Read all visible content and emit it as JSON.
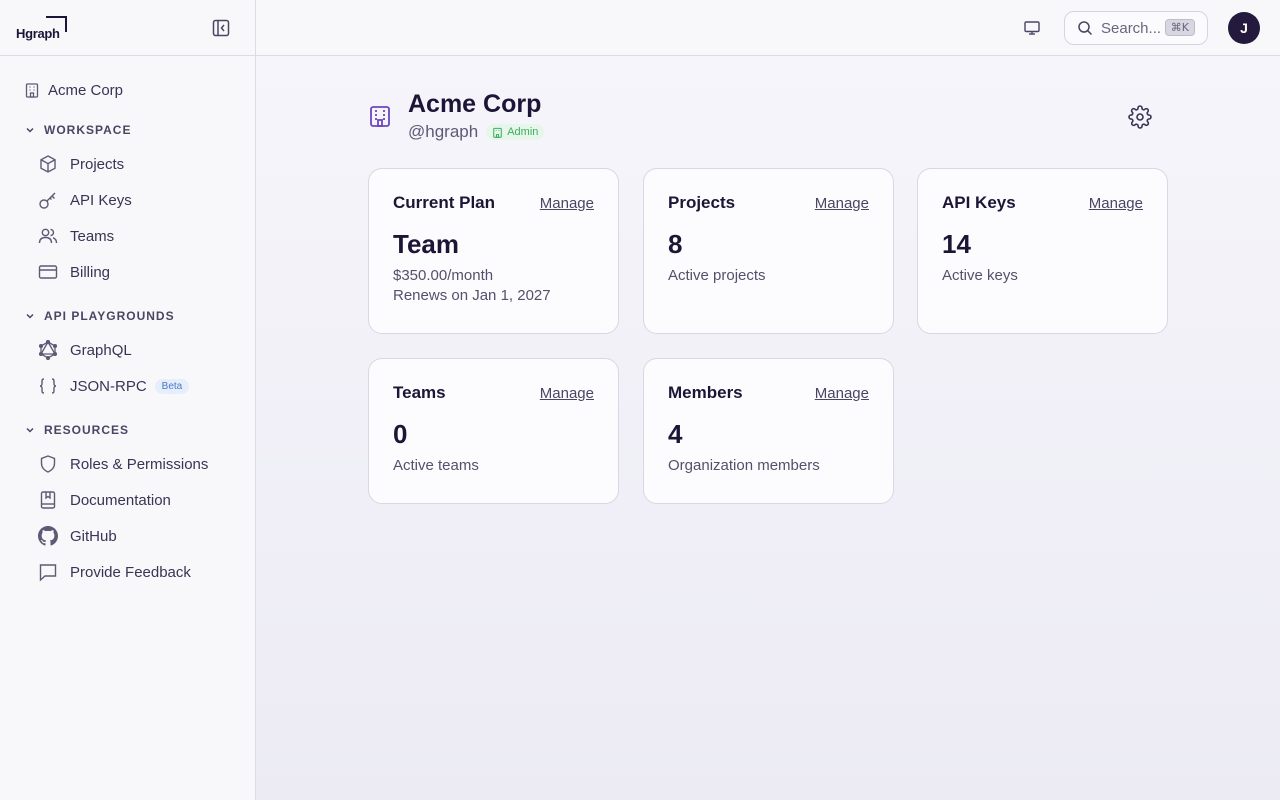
{
  "app": {
    "logo": "Hgraph"
  },
  "sidebar": {
    "org": "Acme Corp",
    "sections": [
      {
        "title": "WORKSPACE",
        "items": [
          {
            "label": "Projects",
            "icon": "cube-icon"
          },
          {
            "label": "API Keys",
            "icon": "key-icon"
          },
          {
            "label": "Teams",
            "icon": "users-icon"
          },
          {
            "label": "Billing",
            "icon": "credit-card-icon"
          }
        ]
      },
      {
        "title": "API PLAYGROUNDS",
        "items": [
          {
            "label": "GraphQL",
            "icon": "graphql-icon"
          },
          {
            "label": "JSON-RPC",
            "icon": "braces-icon",
            "badge": "Beta"
          }
        ]
      },
      {
        "title": "RESOURCES",
        "items": [
          {
            "label": "Roles & Permissions",
            "icon": "shield-icon"
          },
          {
            "label": "Documentation",
            "icon": "book-icon"
          },
          {
            "label": "GitHub",
            "icon": "github-icon"
          },
          {
            "label": "Provide Feedback",
            "icon": "message-icon"
          }
        ]
      }
    ]
  },
  "header": {
    "search_placeholder": "Search...",
    "search_shortcut": "⌘K",
    "avatar_initial": "J"
  },
  "org": {
    "name": "Acme Corp",
    "handle": "@hgraph",
    "role_badge": "Admin"
  },
  "cards": [
    {
      "title": "Current Plan",
      "action": "Manage",
      "value": "Team",
      "lines": [
        "$350.00/month",
        "Renews on Jan 1, 2027"
      ]
    },
    {
      "title": "Projects",
      "action": "Manage",
      "value": "8",
      "lines": [
        "Active projects"
      ]
    },
    {
      "title": "API Keys",
      "action": "Manage",
      "value": "14",
      "lines": [
        "Active keys"
      ]
    },
    {
      "title": "Teams",
      "action": "Manage",
      "value": "0",
      "lines": [
        "Active teams"
      ]
    },
    {
      "title": "Members",
      "action": "Manage",
      "value": "4",
      "lines": [
        "Organization members"
      ]
    }
  ],
  "colors": {
    "accent": "#6b46c1",
    "admin_green": "#3eae5e",
    "beta_blue": "#4a78c8"
  }
}
